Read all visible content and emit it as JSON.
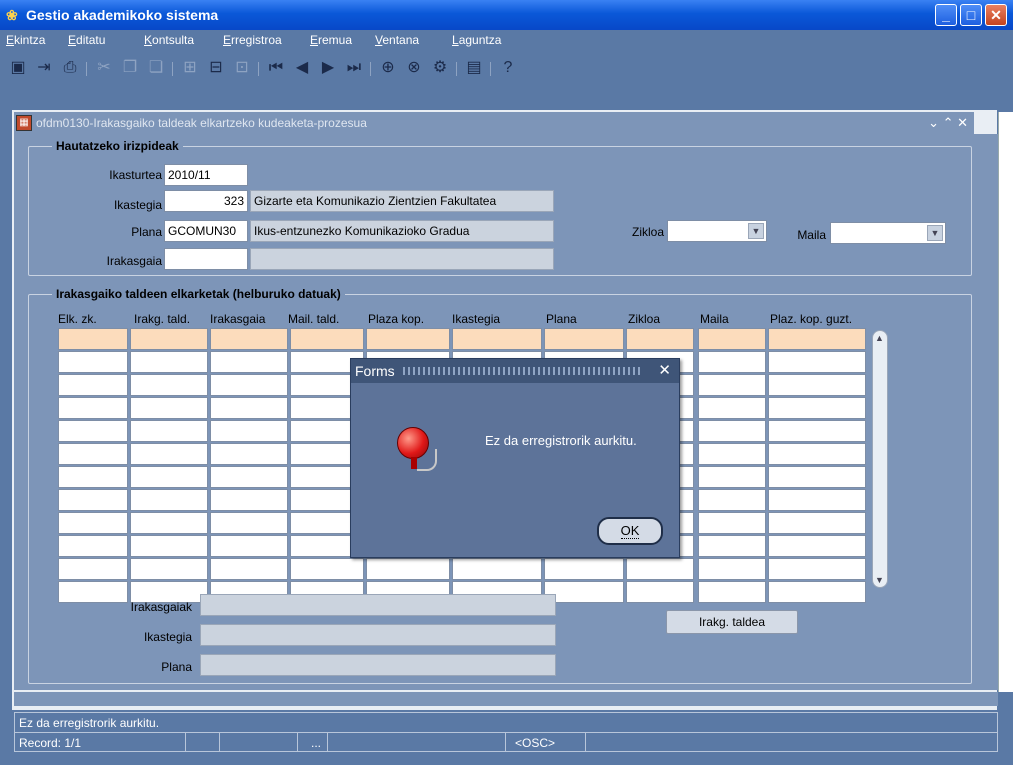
{
  "window": {
    "title": "Gestio akademikoko sistema"
  },
  "menu": [
    "Ekintza",
    "Editatu",
    "Kontsulta",
    "Erregistroa",
    "Eremua",
    "Ventana",
    "Laguntza"
  ],
  "form": {
    "title": "ofdm0130-Irakasgaiko taldeak elkartzeko kudeaketa-prozesua"
  },
  "criteria": {
    "group_title": "Hautatzeko irizpideak",
    "ikasturtea_label": "Ikasturtea",
    "ikasturtea_value": "2010/11",
    "ikastegia_label": "Ikastegia",
    "ikastegia_code": "323",
    "ikastegia_name": "Gizarte eta Komunikazio Zientzien Fakultatea",
    "plana_label": "Plana",
    "plana_code": "GCOMUN30",
    "plana_name": "Ikus-entzunezko Komunikazioko Gradua",
    "irakasgaia_label": "Irakasgaia",
    "zikloa_label": "Zikloa",
    "maila_label": "Maila"
  },
  "target": {
    "group_title": "Irakasgaiko taldeen elkarketak (helburuko datuak)",
    "columns": [
      "Elk. zk.",
      "Irakg. tald.",
      "Irakasgaia",
      "Mail. tald.",
      "Plaza kop.",
      "Ikastegia",
      "Plana",
      "Zikloa",
      "Maila",
      "Plaz. kop. guzt."
    ]
  },
  "detail": {
    "irakasgaiak_label": "Irakasgaiak",
    "ikastegia_label": "Ikastegia",
    "plana_label": "Plana",
    "taldea_button": "Irakg. taldea"
  },
  "dialog": {
    "title": "Forms",
    "message": "Ez da erregistrorik aurkitu.",
    "ok_label": "OK"
  },
  "status": {
    "message": "Ez da erregistrorik aurkitu.",
    "record": "Record: 1/1",
    "ellipsis": "...",
    "mode": "<OSC>"
  },
  "icons": [
    "save-icon",
    "exit-icon",
    "print-icon",
    "cut-icon",
    "copy-icon",
    "paste-icon",
    "insert-record-icon",
    "delete-record-icon",
    "duplicate-record-icon",
    "first-record-icon",
    "previous-record-icon",
    "next-record-icon",
    "last-record-icon",
    "enter-query-icon",
    "cancel-query-icon",
    "execute-query-icon",
    "edit-icon",
    "help-icon"
  ],
  "colors": {
    "titlebar": "#0a58d8",
    "panel": "#7d95b8",
    "highlight_row": "#fcdcbc",
    "dialog": "#5d7399"
  }
}
